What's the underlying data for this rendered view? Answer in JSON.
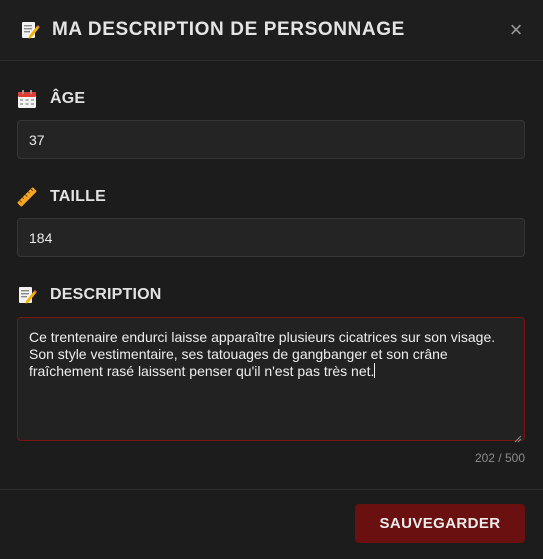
{
  "modal": {
    "title": "MA DESCRIPTION DE PERSONNAGE",
    "title_icon": "memo-icon",
    "close_label": "×"
  },
  "fields": {
    "age": {
      "icon": "calendar-icon",
      "label": "ÂGE",
      "value": "37"
    },
    "height": {
      "icon": "ruler-icon",
      "label": "TAILLE",
      "value": "184"
    },
    "description": {
      "icon": "memo-icon",
      "label": "DESCRIPTION",
      "value": "Ce trentenaire endurci laisse apparaître plusieurs cicatrices sur son visage. Son style vestimentaire, ses tatouages de gangbanger et son crâne fraîchement rasé laissent penser qu'il n'est pas très net.",
      "counter": "202 / 500"
    }
  },
  "footer": {
    "save_label": "SAUVEGARDER"
  },
  "colors": {
    "accent": "#6b1010",
    "focus_border": "#7a1515",
    "background": "#1c1c1c"
  }
}
